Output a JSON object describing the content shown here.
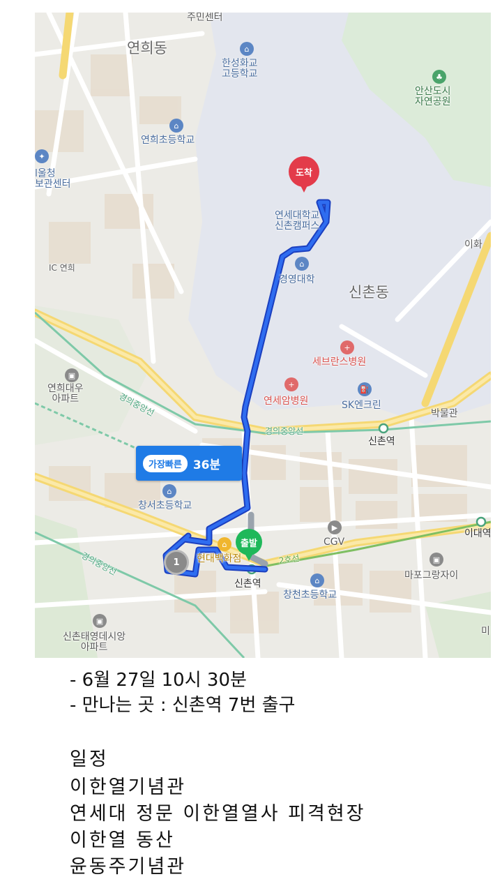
{
  "map": {
    "places": {
      "yeonhui_dong": "연희동",
      "jumin_center": "주민센터",
      "hanseong_school": "한성화교\n고등학교",
      "ansan_park": "안산도시\n자연공원",
      "yeonhui_elementary": "연희초등학교",
      "gu_office": "l울청\n보관센터",
      "yonsei": "연세대학교\n신촌캠퍼스",
      "ihwa": "이화",
      "ic_yeonhui": "IC 연희",
      "business_college": "경영대학",
      "sinchon_dong": "신촌동",
      "severance": "세브란스병원",
      "yeonhui_apt": "연희대우\n아파트",
      "cancer_hospital": "연세암병원",
      "sk_energy": "SK엔크린",
      "museum": "박물관",
      "gyeongui_line_1": "경의중앙선",
      "gyeongui_line_2": "경의중앙선",
      "sinchon_station_top": "신촌역",
      "changseo_elementary": "창서초등학교",
      "hyundai_dept": "현대백화점",
      "cgv": "CGV",
      "ewha_station": "이대역",
      "line2": "2호선",
      "mapo_apt": "마포그랑자이",
      "gyeongui_line_3": "경의중앙선",
      "sinchon_station": "신촌역",
      "changcheon_elementary": "창천초등학교",
      "taeyoung_apt": "신촌태영데시앙\n아파트",
      "mi": "미"
    },
    "pin_end": "도착",
    "pin_start": "출발",
    "waypoint": "1",
    "route_tag": "가장빠른",
    "route_time": "36분"
  },
  "info": {
    "date_line": "- 6월 27일 10시 30분",
    "meet_line": "-  만나는 곳 : 신촌역 7번 출구"
  },
  "schedule": {
    "title": "일정",
    "items": [
      "이한열기념관",
      "연세대  정문 이한열열사 피격현장",
      "이한열 동산",
      "윤동주기념관"
    ]
  }
}
